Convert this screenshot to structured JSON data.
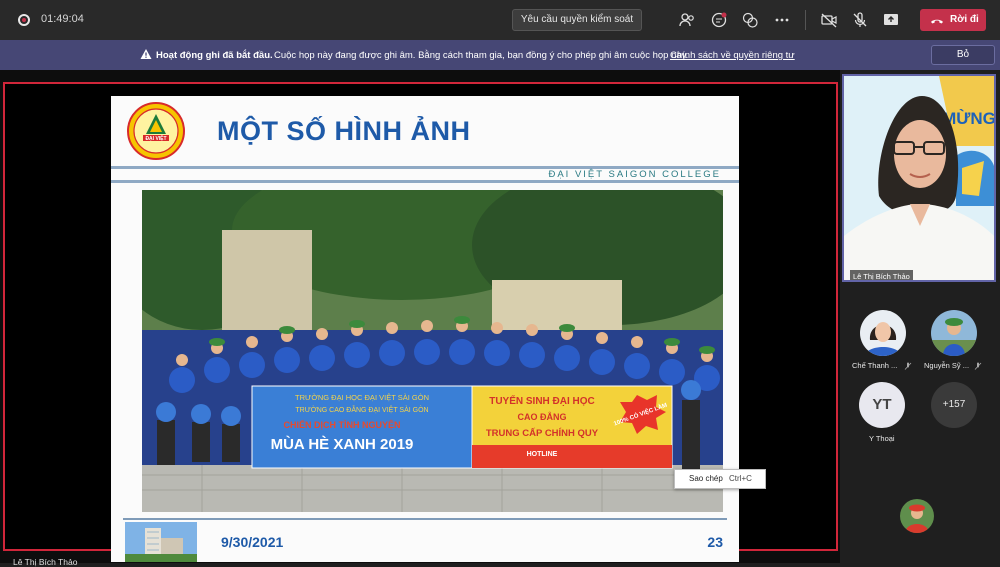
{
  "top_bar": {
    "elapsed_time": "01:49:04",
    "request_control_label": "Yêu cầu quyền kiểm soát",
    "leave_label": "Rời đi",
    "icons": [
      "record-icon",
      "participants-icon",
      "chat-icon",
      "reactions-icon",
      "more-icon",
      "camera-off-icon",
      "mic-off-icon",
      "share-icon",
      "phone-icon"
    ]
  },
  "recording_banner": {
    "title": "Hoạt động ghi đã bắt đầu.",
    "message": "Cuộc họp này đang được ghi âm. Bằng cách tham gia, bạn đồng ý cho phép ghi âm cuộc họp này.",
    "privacy_link": "Chính sách về quyền riêng tư",
    "dismiss_label": "Bỏ"
  },
  "shared_slide": {
    "title": "MỘT SỐ HÌNH ẢNH",
    "college": "ĐẠI VIỆT SAIGON COLLEGE",
    "date": "9/30/2021",
    "page": "23",
    "logo_text": "ĐẠI VIỆT",
    "banner_left": {
      "line1": "TRƯỜNG ĐẠI HỌC ĐẠI VIỆT SÀI GÒN",
      "line2": "TRƯỜNG CAO ĐẲNG ĐẠI VIỆT SÀI GÒN",
      "line3": "CHIẾN DỊCH TÌNH NGUYỆN",
      "line4": "MÙA HÈ XANH 2019"
    },
    "banner_right": {
      "line1": "TUYỂN SINH ĐẠI HỌC",
      "line2": "CAO ĐẲNG",
      "line3": "TRUNG CẤP CHÍNH QUY",
      "line4": "HOTLINE",
      "badge": "100% CÓ VIỆC LÀM"
    }
  },
  "context_tooltip": {
    "label": "Sao chép",
    "shortcut": "Ctrl+C"
  },
  "presenter_name": "Lê Thị Bích Thảo",
  "video_tile": {
    "name": "Lê Thị Bích Thảo",
    "background_text": "MỪNG"
  },
  "participants": [
    {
      "name": "Chế Thanh ..."
    },
    {
      "name": "Nguyễn Sỹ ..."
    },
    {
      "name": "Y Thoại",
      "initials": "YT"
    }
  ],
  "overflow_count": "+157"
}
